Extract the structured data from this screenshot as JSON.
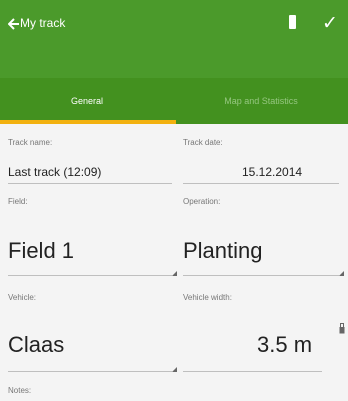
{
  "appbar": {
    "title": "My track",
    "back_icon": "back-arrow-icon",
    "flag_icon": "flag-icon",
    "check_icon": "check-icon"
  },
  "tabs": [
    {
      "label": "General"
    },
    {
      "label": "Map and Statistics"
    }
  ],
  "form": {
    "track_name": {
      "label": "Track name:",
      "value": "Last track (12:09)"
    },
    "track_date": {
      "label": "Track date:",
      "value": "15.12.2014"
    },
    "field": {
      "label": "Field:",
      "value": "Field 1"
    },
    "operation": {
      "label": "Operation:",
      "value": "Planting"
    },
    "vehicle": {
      "label": "Vehicle:",
      "value": "Claas"
    },
    "vehicle_width": {
      "label": "Vehicle width:",
      "value": "3.5 m"
    },
    "notes": {
      "label": "Notes:"
    }
  },
  "colors": {
    "appbar": "#4b9a2b",
    "tabs": "#43911f",
    "tab_indicator": "#f2b10f"
  }
}
